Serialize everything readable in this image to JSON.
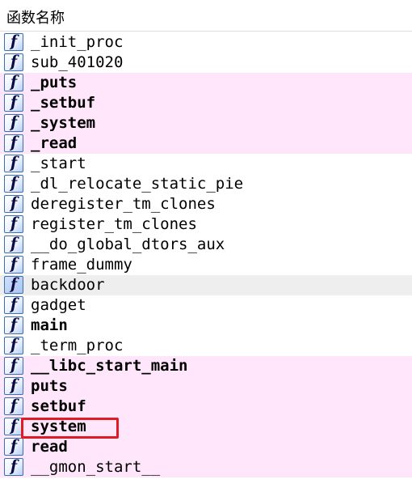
{
  "header": {
    "title": "函数名称"
  },
  "icon_glyph": "f",
  "colors": {
    "library_row": "#ffe6fb",
    "selected_row": "#eeeeee",
    "highlight": "#e01b24"
  },
  "functions": [
    {
      "name": "_init_proc",
      "bold": false,
      "lib": false,
      "selected": false
    },
    {
      "name": "sub_401020",
      "bold": false,
      "lib": false,
      "selected": false
    },
    {
      "name": "_puts",
      "bold": true,
      "lib": true,
      "selected": false
    },
    {
      "name": "_setbuf",
      "bold": true,
      "lib": true,
      "selected": false
    },
    {
      "name": "_system",
      "bold": true,
      "lib": true,
      "selected": false
    },
    {
      "name": "_read",
      "bold": true,
      "lib": true,
      "selected": false
    },
    {
      "name": "_start",
      "bold": false,
      "lib": false,
      "selected": false
    },
    {
      "name": "_dl_relocate_static_pie",
      "bold": false,
      "lib": false,
      "selected": false
    },
    {
      "name": "deregister_tm_clones",
      "bold": false,
      "lib": false,
      "selected": false
    },
    {
      "name": "register_tm_clones",
      "bold": false,
      "lib": false,
      "selected": false
    },
    {
      "name": "__do_global_dtors_aux",
      "bold": false,
      "lib": false,
      "selected": false
    },
    {
      "name": "frame_dummy",
      "bold": false,
      "lib": false,
      "selected": false
    },
    {
      "name": "backdoor",
      "bold": false,
      "lib": false,
      "selected": true
    },
    {
      "name": "gadget",
      "bold": false,
      "lib": false,
      "selected": false
    },
    {
      "name": "main",
      "bold": true,
      "lib": false,
      "selected": false
    },
    {
      "name": "_term_proc",
      "bold": false,
      "lib": false,
      "selected": false
    },
    {
      "name": "__libc_start_main",
      "bold": true,
      "lib": true,
      "selected": false
    },
    {
      "name": "puts",
      "bold": true,
      "lib": true,
      "selected": false
    },
    {
      "name": "setbuf",
      "bold": true,
      "lib": true,
      "selected": false
    },
    {
      "name": "system",
      "bold": true,
      "lib": true,
      "selected": false
    },
    {
      "name": "read",
      "bold": true,
      "lib": true,
      "selected": false
    },
    {
      "name": "__gmon_start__",
      "bold": false,
      "lib": true,
      "selected": false
    }
  ]
}
